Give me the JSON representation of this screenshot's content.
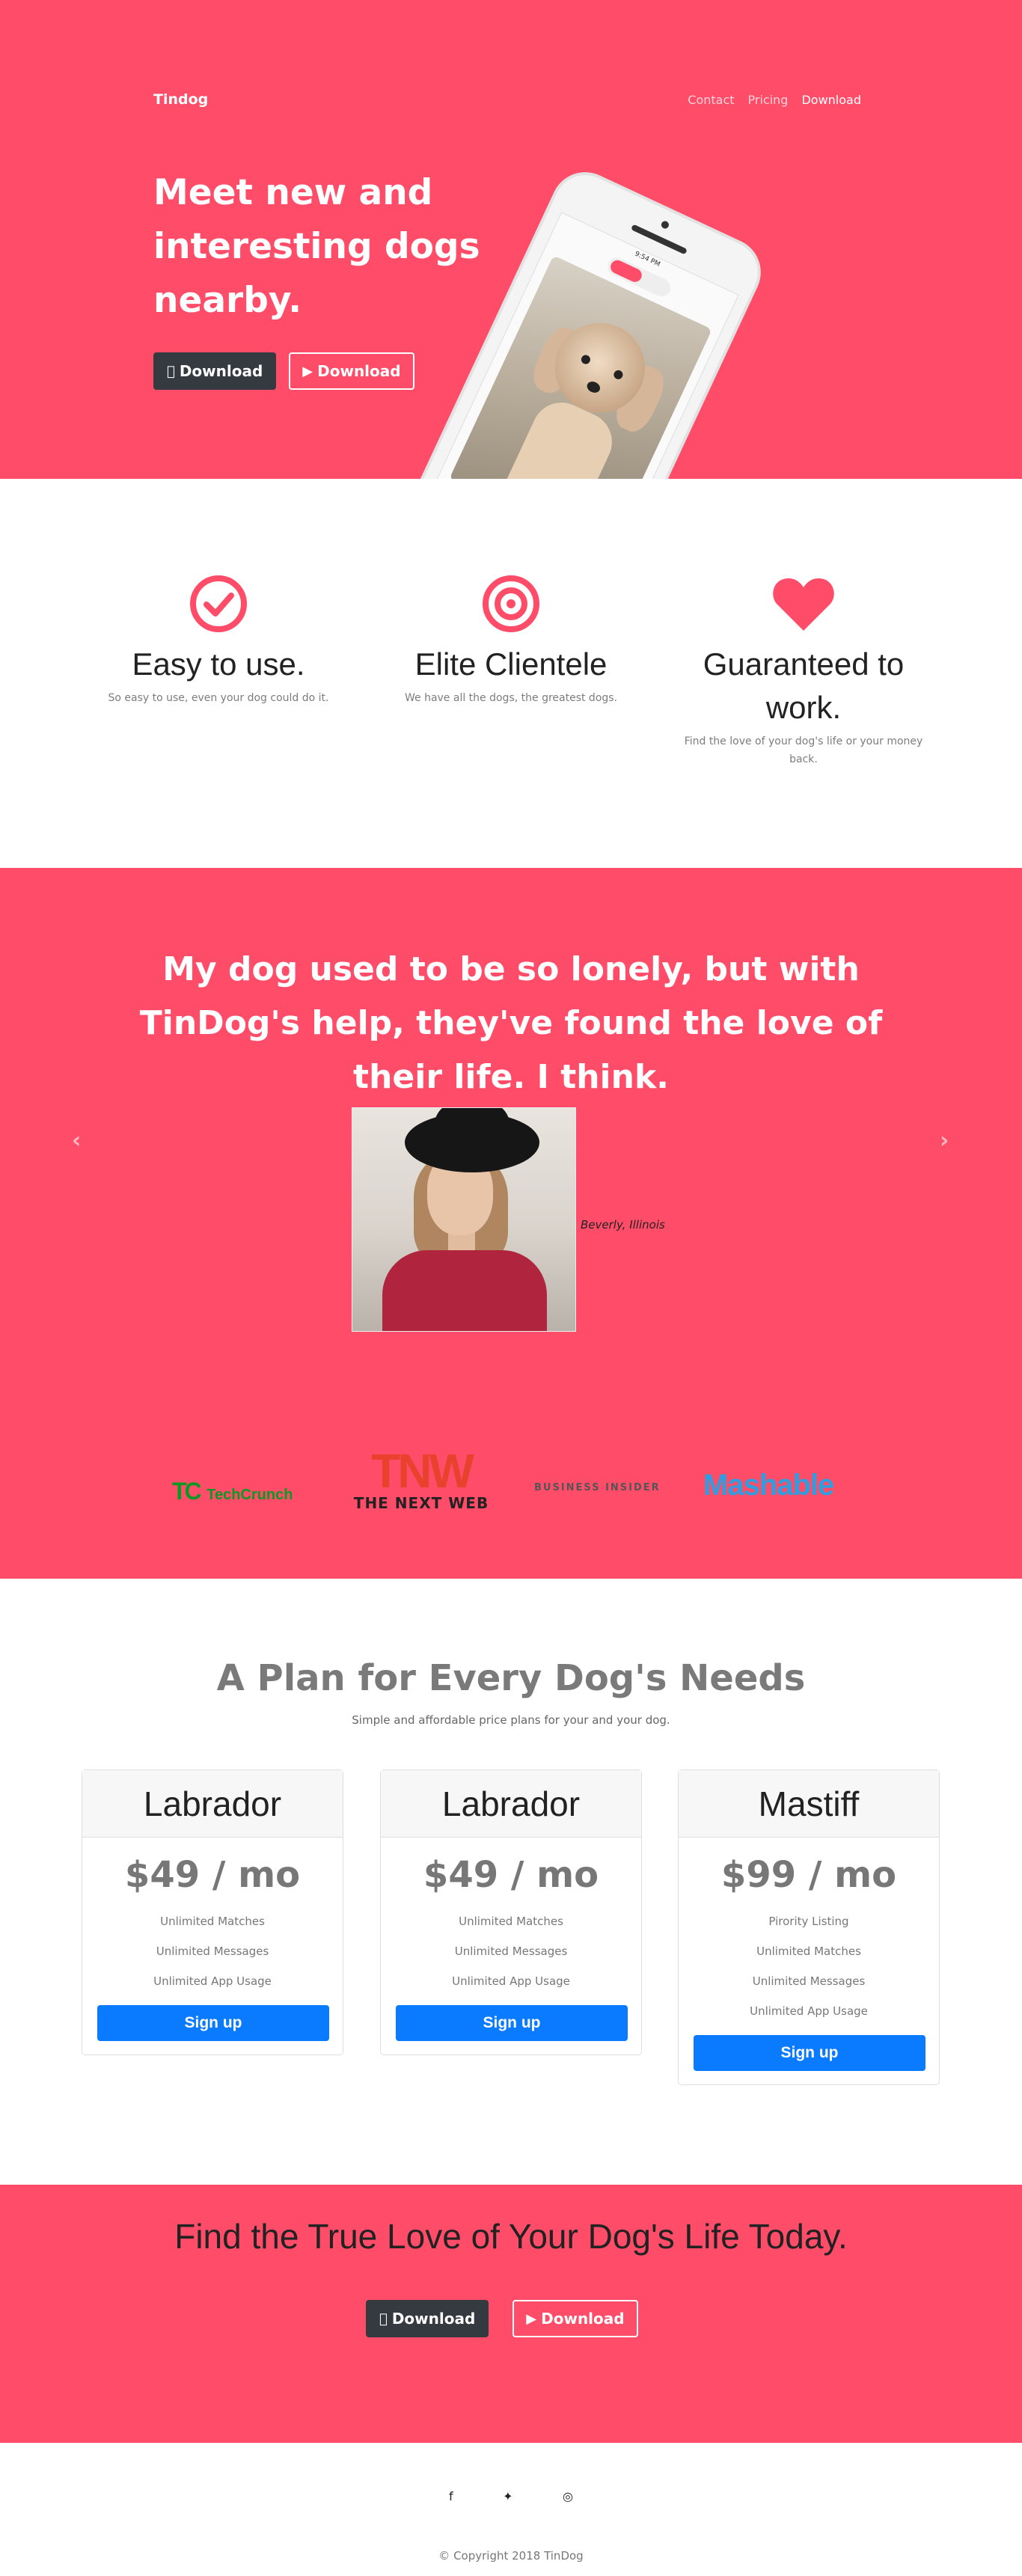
{
  "nav": {
    "brand": "Tindog",
    "links": [
      "Contact",
      "Pricing",
      "Download"
    ]
  },
  "hero": {
    "title": "Meet new and interesting dogs nearby.",
    "btn_apple": "Download",
    "btn_play": "Download",
    "phone": {
      "status": "9:54 PM"
    }
  },
  "features": [
    {
      "icon": "check-circle-icon",
      "title": "Easy to use.",
      "text": "So easy to use, even your dog could do it."
    },
    {
      "icon": "bullseye-icon",
      "title": "Elite Clientele",
      "text": "We have all the dogs, the greatest dogs."
    },
    {
      "icon": "heart-icon",
      "title": "Guaranteed to work.",
      "text": "Find the love of your dog's life or your money back."
    }
  ],
  "testimonial": {
    "quote": "My dog used to be so lonely, but with TinDog's help, they've found the love of their life. I think.",
    "caption": "Beverly, Illinois"
  },
  "press": {
    "techcrunch": "TechCrunch",
    "tnw_big": "TNW",
    "tnw_small": "THE NEXT WEB",
    "business_insider": "BUSINESS INSIDER",
    "mashable": "Mashable"
  },
  "pricing": {
    "title": "A Plan for Every Dog's Needs",
    "subtitle": "Simple and affordable price plans for your and your dog.",
    "plans": [
      {
        "name": "Labrador",
        "price": "$49 / mo",
        "features": [
          "Unlimited Matches",
          "Unlimited Messages",
          "Unlimited App Usage"
        ],
        "button": "Sign up"
      },
      {
        "name": "Labrador",
        "price": "$49 / mo",
        "features": [
          "Unlimited Matches",
          "Unlimited Messages",
          "Unlimited App Usage"
        ],
        "button": "Sign up"
      },
      {
        "name": "Mastiff",
        "price": "$99 / mo",
        "features": [
          "Pirority Listing",
          "Unlimited Matches",
          "Unlimited Messages",
          "Unlimited App Usage"
        ],
        "button": "Sign up"
      }
    ]
  },
  "cta": {
    "title": "Find the True Love of Your Dog's Life Today.",
    "btn_apple": "Download",
    "btn_play": "Download"
  },
  "footer": {
    "social": [
      "facebook-icon",
      "twitter-icon",
      "instagram-icon"
    ],
    "copyright": "© Copyright 2018 TinDog"
  },
  "colors": {
    "brand": "#ff4c68",
    "dark_button": "#343a40",
    "primary_button": "#0a7bff"
  }
}
